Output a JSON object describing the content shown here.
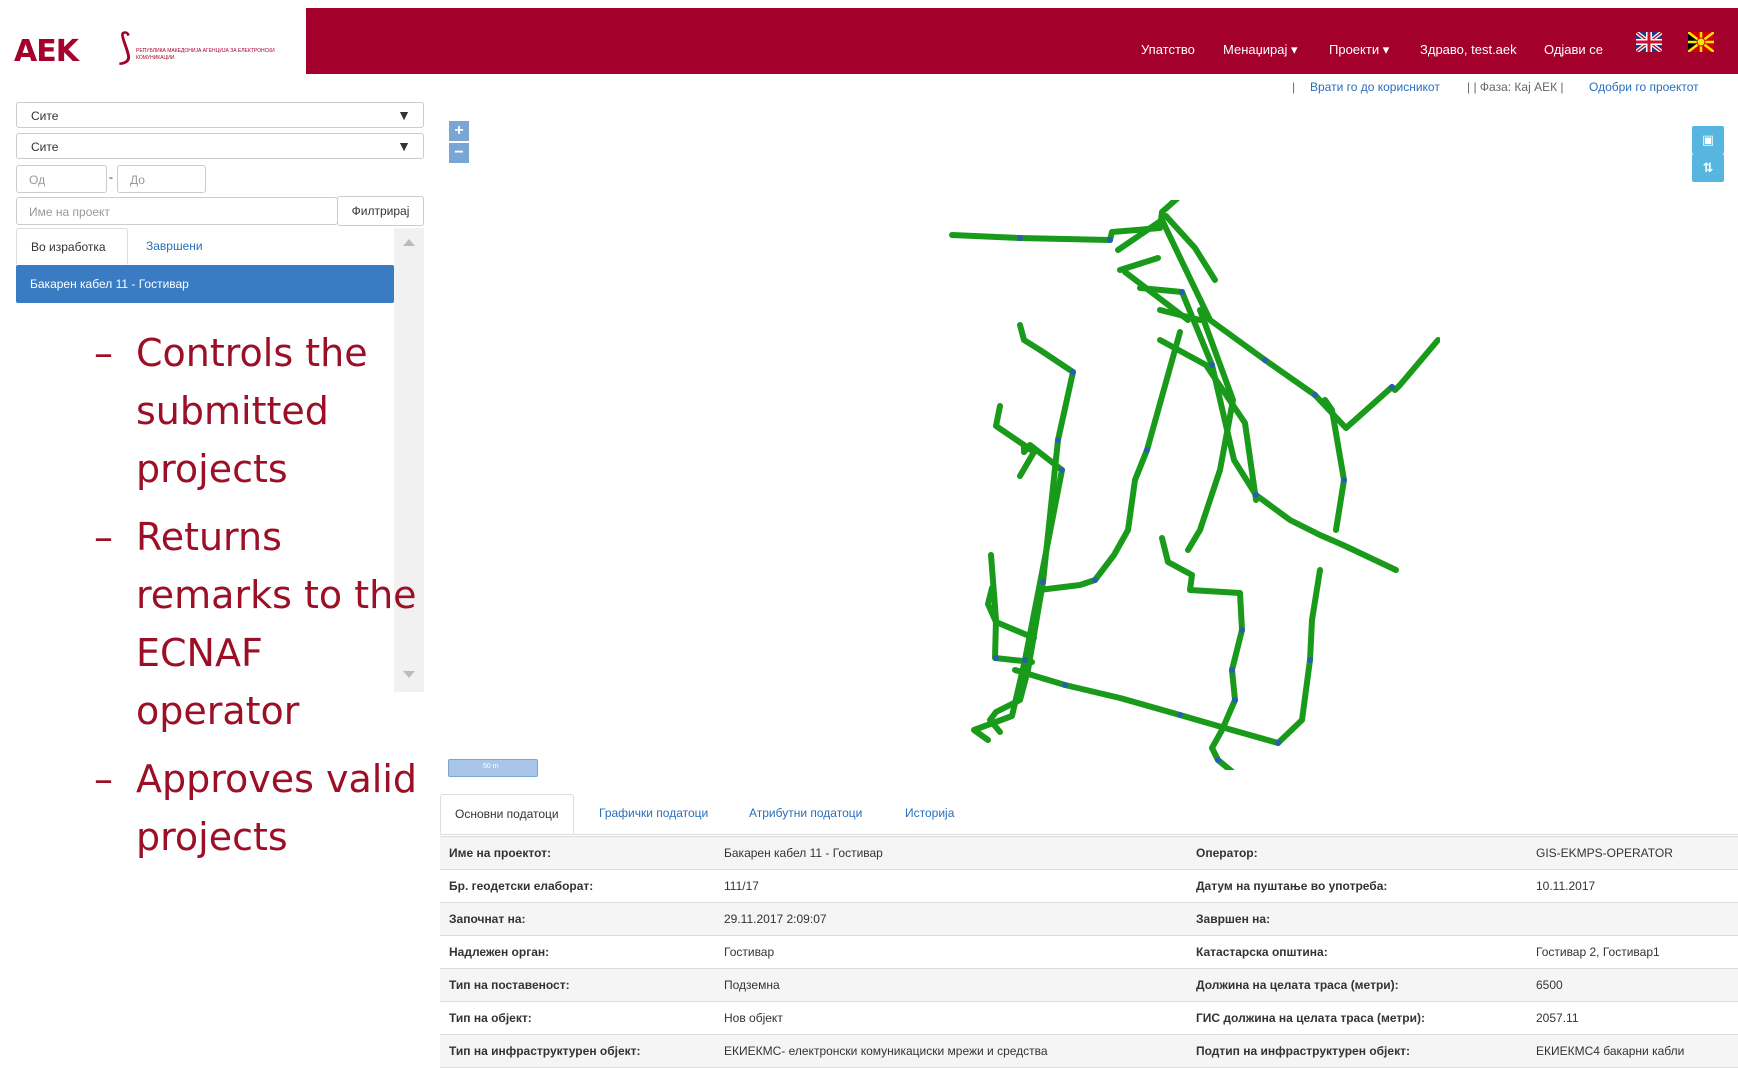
{
  "header": {
    "logo_text": "AEK",
    "logo_subtitle": "РЕПУБЛИКА МАКЕДОНИЈА АГЕНЦИЈА ЗА ЕЛЕКТРОНСКИ КОМУНИКАЦИИ",
    "nav": {
      "manual": "Упатство",
      "manage": "Менаџирај ▾",
      "projects": "Проекти ▾",
      "greeting": "Здраво, test.aek",
      "logout": "Одјави се"
    }
  },
  "subbar": {
    "sep1": "|",
    "return_link": "Врати го до корисникот",
    "phase": "| | Фаза: Кај АЕК |",
    "approve_link": "Одобри го проектот"
  },
  "filters": {
    "select1": "Сите",
    "select2": "Сите",
    "from_placeholder": "Од",
    "dash": "-",
    "to_placeholder": "До",
    "name_placeholder": "Име на проект",
    "filter_button": "Филтрирај"
  },
  "left_tabs": {
    "in_progress": "Во изработка",
    "finished": "Завршени"
  },
  "project_list": [
    "Бакарен кабел 11 - Гостивар"
  ],
  "bullets": [
    "Controls the submitted projects",
    "Returns remarks to the ECNAF operator",
    "Approves valid projects"
  ],
  "map": {
    "zoom_in": "+",
    "zoom_out": "−",
    "scale_label": "50 m",
    "route_color": "#1a9a1a",
    "node_color": "#2a5db0"
  },
  "bottom_tabs": [
    "Основни податоци",
    "Графички податоци",
    "Атрибутни податоци",
    "Историја"
  ],
  "details": {
    "rows": [
      {
        "l1": "Име на проектот:",
        "v1": "Бакарен кабел 11 - Гостивар",
        "l2": "Оператор:",
        "v2": "GIS-EKMPS-OPERATOR"
      },
      {
        "l1": "Бр. геодетски елаборат:",
        "v1": "111/17",
        "l2": "Датум на пуштање во употреба:",
        "v2": "10.11.2017"
      },
      {
        "l1": "Започнат на:",
        "v1": "29.11.2017 2:09:07",
        "l2": "Завршен на:",
        "v2": ""
      },
      {
        "l1": "Надлежен орган:",
        "v1": "Гостивар",
        "l2": "Катастарска општина:",
        "v2": "Гостивар 2, Гостивар1"
      },
      {
        "l1": "Тип на поставеност:",
        "v1": "Подземна",
        "l2": "Должина на целата траса (метри):",
        "v2": "6500"
      },
      {
        "l1": "Тип на објект:",
        "v1": "Нов објект",
        "l2": "ГИС должина на целата траса (метри):",
        "v2": "2057.11"
      },
      {
        "l1": "Тип на инфраструктурен објект:",
        "v1": "ЕКИЕКМС- електронски комуникациски мрежи и средства",
        "l2": "Подтип на инфраструктурен објект:",
        "v2": "ЕКИЕКМС4 бакарни кабли"
      }
    ]
  }
}
